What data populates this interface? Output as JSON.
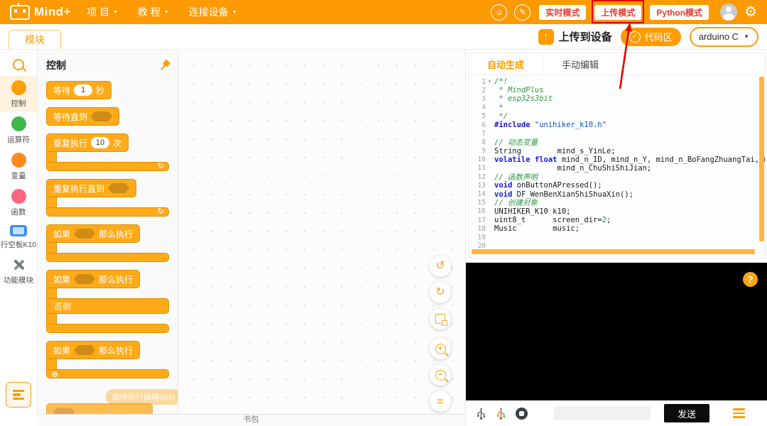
{
  "colors": {
    "accent": "#FF9C00",
    "block_orange": "#FFAB19",
    "annotation_red": "#E50000",
    "mode_text_red": "#E23B2E"
  },
  "topbar": {
    "logo_text": "Mind+",
    "menus": [
      {
        "label": "项 目"
      },
      {
        "label": "教 程"
      },
      {
        "label": "连接设备"
      }
    ],
    "modes": [
      {
        "label": "实时模式"
      },
      {
        "label": "上传模式"
      },
      {
        "label": "Python模式"
      }
    ]
  },
  "toolbar": {
    "modules_tab": "模块",
    "upload_device": "上传到设备",
    "code_area": "代码区",
    "language": "arduino C"
  },
  "sidebar": {
    "categories": [
      {
        "label": "控制",
        "color": "#FF9F0A"
      },
      {
        "label": "运算符",
        "color": "#3EB84B"
      },
      {
        "label": "变量",
        "color": "#FF8A1E"
      },
      {
        "label": "函数",
        "color": "#FF6680"
      },
      {
        "label": "行空板K10",
        "color": "#418DF0"
      },
      {
        "label": "功能模块",
        "color": "#8A9199"
      }
    ]
  },
  "palette": {
    "header": "控制",
    "wait": {
      "pre": "等待",
      "value": "1",
      "post": "秒"
    },
    "wait_until": {
      "label": "等待直到"
    },
    "repeat": {
      "pre": "重复执行",
      "value": "10",
      "post": "次"
    },
    "repeat_until": {
      "label": "重复执行直到"
    },
    "if_then": {
      "pre": "如果",
      "post": "那么执行"
    },
    "if_else": {
      "pre": "如果",
      "post": "那么执行",
      "else_label": "否则"
    },
    "ghost_label": "循环执行间隔(ms)"
  },
  "canvas": {
    "backpack_label": "书包"
  },
  "code": {
    "tabs": [
      {
        "label": "自动生成"
      },
      {
        "label": "手动编辑"
      }
    ],
    "lines": [
      {
        "n": 1,
        "fold": true,
        "tokens": [
          [
            "c",
            "/*!"
          ]
        ]
      },
      {
        "n": 2,
        "tokens": [
          [
            "c",
            " * MindPlus"
          ]
        ]
      },
      {
        "n": 3,
        "tokens": [
          [
            "c",
            " * esp32s3bit"
          ]
        ]
      },
      {
        "n": 4,
        "tokens": [
          [
            "c",
            " *"
          ]
        ]
      },
      {
        "n": 5,
        "tokens": [
          [
            "c",
            " */"
          ]
        ]
      },
      {
        "n": 6,
        "tokens": [
          [
            "k",
            "#include"
          ],
          [
            "s",
            " \"unihiker_k10.h\""
          ]
        ]
      },
      {
        "n": 7,
        "tokens": []
      },
      {
        "n": 8,
        "tokens": [
          [
            "c",
            "// 动态变量"
          ]
        ]
      },
      {
        "n": 9,
        "tokens": [
          [
            "p",
            "String        mind_s_YinLe;"
          ]
        ]
      },
      {
        "n": 10,
        "tokens": [
          [
            "k",
            "volatile float"
          ],
          [
            "p",
            " mind_n_ID, mind_n_Y, mind_n_BoFangZhuangTai, min"
          ]
        ]
      },
      {
        "n": 11,
        "tokens": [
          [
            "p",
            "              mind_n_ChuShiShiJian;"
          ]
        ]
      },
      {
        "n": 12,
        "tokens": [
          [
            "c",
            "// 函数声明"
          ]
        ]
      },
      {
        "n": 13,
        "tokens": [
          [
            "k",
            "void"
          ],
          [
            "p",
            " onButtonAPressed();"
          ]
        ]
      },
      {
        "n": 14,
        "tokens": [
          [
            "k",
            "void"
          ],
          [
            "p",
            " DF_WenBenXianShiShuaXin();"
          ]
        ]
      },
      {
        "n": 15,
        "tokens": [
          [
            "c",
            "// 创建对象"
          ]
        ]
      },
      {
        "n": 16,
        "tokens": [
          [
            "p",
            "UNIHIKER_K10 k10;"
          ]
        ]
      },
      {
        "n": 17,
        "tokens": [
          [
            "p",
            "uint8_t      screen_dir="
          ],
          [
            "num",
            "2"
          ],
          [
            "p",
            ";"
          ]
        ]
      },
      {
        "n": 18,
        "tokens": [
          [
            "p",
            "Music        music;"
          ]
        ]
      },
      {
        "n": 19,
        "tokens": []
      },
      {
        "n": 20,
        "tokens": []
      }
    ]
  },
  "serial": {
    "send_label": "发送",
    "help_label": "?"
  },
  "icons": {
    "undo": "↺",
    "redo": "↻",
    "zoom_in": "+",
    "zoom_out": "−",
    "zoom_reset": "=",
    "gear": "⚙",
    "feedback": "☺",
    "edit": "✎",
    "caret": "▼",
    "check": "✓",
    "up_arrow": "↑",
    "loop": "↻",
    "plus_circle": "⊕"
  }
}
